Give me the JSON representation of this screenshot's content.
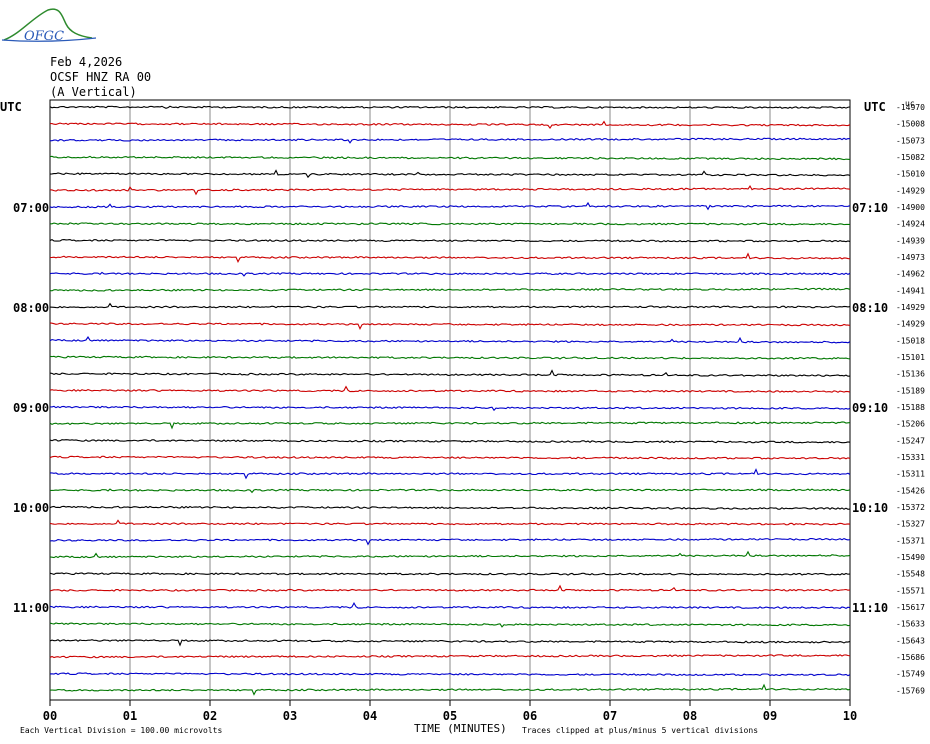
{
  "logo": {
    "text": "OFGC",
    "color": "#2a5ab8",
    "accent": "#2e8b2e"
  },
  "header": {
    "date": "Feb 4,2026",
    "station": "OCSF HNZ RA 00",
    "component": "(A Vertical)"
  },
  "labels": {
    "left_tz": "UTC",
    "right_tz": "UTC",
    "right_unit": "uc"
  },
  "footer": {
    "vertical_division": "Each Vertical Division =  100.00 microvolts",
    "xlabel": "TIME (MINUTES)",
    "clip_note": "Traces clipped at plus/minus 5 vertical divisions"
  },
  "chart_data": {
    "type": "line",
    "title": "",
    "xlabel": "TIME (MINUTES)",
    "ylabel": "",
    "x_ticks": [
      "00",
      "01",
      "02",
      "03",
      "04",
      "05",
      "06",
      "07",
      "08",
      "09",
      "10"
    ],
    "xlim": [
      0,
      10
    ],
    "left_time_labels": [
      {
        "row": 6,
        "text": "07:00"
      },
      {
        "row": 12,
        "text": "08:00"
      },
      {
        "row": 18,
        "text": "09:00"
      },
      {
        "row": 24,
        "text": "10:00"
      },
      {
        "row": 30,
        "text": "11:00"
      }
    ],
    "right_time_labels": [
      {
        "row": 6,
        "text": "07:10"
      },
      {
        "row": 12,
        "text": "08:10"
      },
      {
        "row": 18,
        "text": "09:10"
      },
      {
        "row": 24,
        "text": "10:10"
      },
      {
        "row": 30,
        "text": "11:10"
      }
    ],
    "trace_colors": [
      "#000000",
      "#cc0000",
      "#0000cc",
      "#007700"
    ],
    "trace_offsets": [
      "-14970",
      "-15008",
      "-15073",
      "-15082",
      "-15010",
      "-14929",
      "-14900",
      "-14924",
      "-14939",
      "-14973",
      "-14962",
      "-14941",
      "-14929",
      "-14929",
      "-15018",
      "-15101",
      "-15136",
      "-15189",
      "-15188",
      "-15206",
      "-15247",
      "-15331",
      "-15311",
      "-15426",
      "-15372",
      "-15327",
      "-15371",
      "-15490",
      "-15548",
      "-15571",
      "-15617",
      "-15633",
      "-15643",
      "-15686",
      "-15749",
      "-15769"
    ],
    "grid": true
  }
}
